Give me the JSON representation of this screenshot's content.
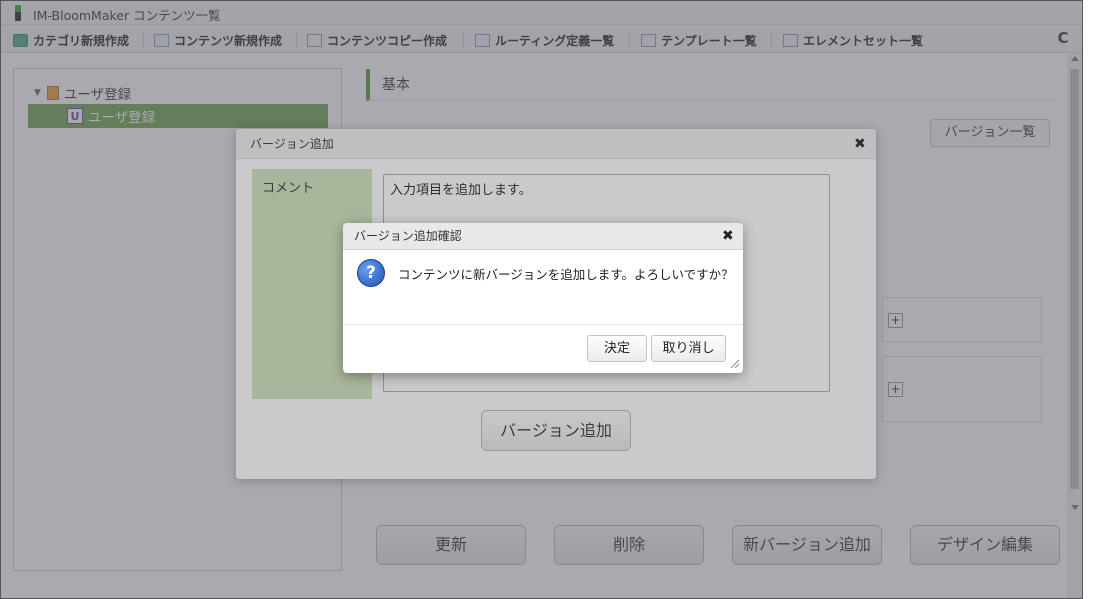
{
  "window": {
    "title": "IM-BloomMaker コンテンツ一覧"
  },
  "toolbar": {
    "items": [
      {
        "label": "カテゴリ新規作成",
        "icon": "folder-add-icon"
      },
      {
        "label": "コンテンツ新規作成",
        "icon": "content-add-icon"
      },
      {
        "label": "コンテンツコピー作成",
        "icon": "copy-icon"
      },
      {
        "label": "ルーティング定義一覧",
        "icon": "list-icon"
      },
      {
        "label": "テンプレート一覧",
        "icon": "list-icon"
      },
      {
        "label": "エレメントセット一覧",
        "icon": "list-icon"
      }
    ],
    "reload_icon": "reload-icon",
    "reload_glyph": "C"
  },
  "tree": {
    "root_label": "ユーザ登録",
    "child_label": "ユーザ登録",
    "child_badge": "U"
  },
  "main": {
    "section_title": "基本",
    "version_list_label": "バージョン一覧",
    "plus_glyph": "+",
    "buttons": {
      "update": "更新",
      "delete": "削除",
      "new_version": "新バージョン追加",
      "design_edit": "デザイン編集"
    }
  },
  "version_dialog": {
    "title": "バージョン追加",
    "close_glyph": "✖",
    "comment_label": "コメント",
    "comment_value": "入力項目を追加します。",
    "add_button": "バージョン追加"
  },
  "confirm_dialog": {
    "title": "バージョン追加確認",
    "close_glyph": "✖",
    "question_glyph": "?",
    "message": "コンテンツに新バージョンを追加します。よろしいですか？",
    "ok_label": "決定",
    "cancel_label": "取り消し"
  },
  "colors": {
    "accent_green": "#6da34d",
    "label_cell": "#cfe3b8",
    "question_blue": "#1e4fb0"
  }
}
